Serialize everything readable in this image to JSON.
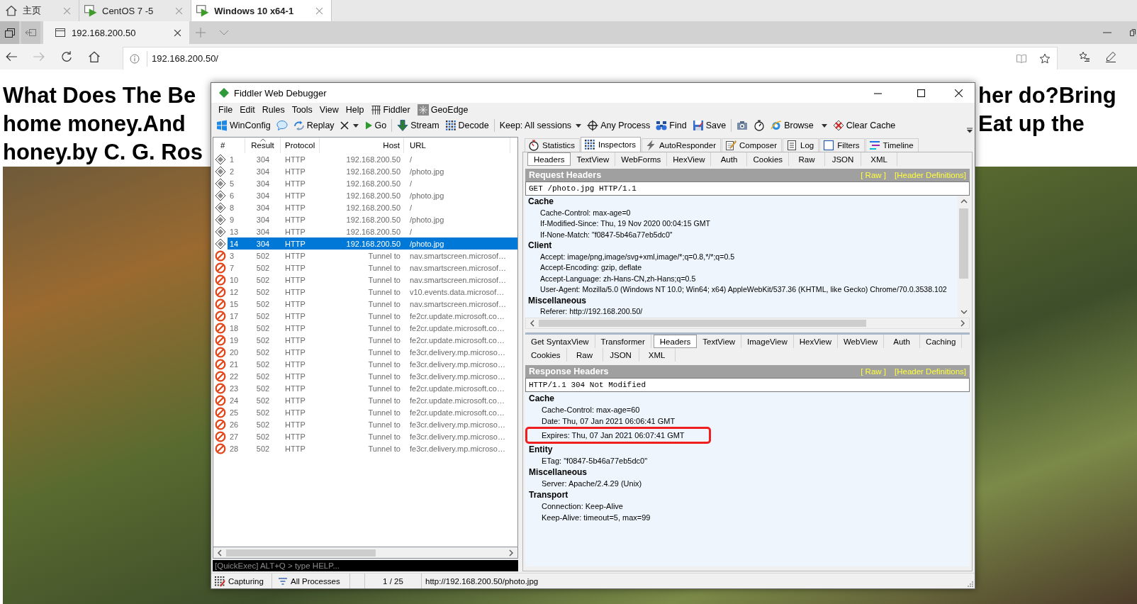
{
  "vm_tabs": [
    {
      "label": "主页",
      "kind": "home",
      "selected": false
    },
    {
      "label": "CentOS 7 -5",
      "kind": "vm",
      "selected": false
    },
    {
      "label": "Windows 10 x64-1",
      "kind": "vm",
      "selected": true
    }
  ],
  "browser": {
    "tab_title": "192.168.200.50",
    "nav": [
      {
        "kind": "back",
        "disabled": false
      },
      {
        "kind": "forward",
        "disabled": true
      },
      {
        "kind": "refresh",
        "disabled": false
      },
      {
        "kind": "home",
        "disabled": false
      }
    ],
    "address": "192.168.200.50/"
  },
  "page": {
    "heading_lines": [
      {
        "left": "What Does The Be",
        "right": "her do?Bring"
      },
      {
        "left": "home money.And",
        "right": "Eat up the"
      },
      {
        "left": "honey.by C. G. Ros"
      }
    ]
  },
  "fiddler": {
    "title": "Fiddler Web Debugger",
    "menu": [
      {
        "label": "File",
        "kind": "plain"
      },
      {
        "label": "Edit",
        "kind": "plain"
      },
      {
        "label": "Rules",
        "kind": "plain"
      },
      {
        "label": "Tools",
        "kind": "plain"
      },
      {
        "label": "View",
        "kind": "plain"
      },
      {
        "label": "Help",
        "kind": "plain"
      },
      {
        "label": "Fiddler",
        "kind": "script"
      },
      {
        "label": "GeoEdge",
        "kind": "addon"
      }
    ],
    "toolbar": [
      {
        "kind": "winconfig",
        "label": "WinConfig"
      },
      {
        "kind": "comment"
      },
      {
        "kind": "replay",
        "label": "Replay"
      },
      {
        "kind": "remove"
      },
      {
        "kind": "go",
        "label": "Go"
      },
      {
        "kind": "separator"
      },
      {
        "kind": "stream",
        "label": "Stream"
      },
      {
        "kind": "decode",
        "label": "Decode"
      },
      {
        "kind": "separator"
      },
      {
        "kind": "keep",
        "label": "Keep: All sessions"
      },
      {
        "kind": "process",
        "label": "Any Process"
      },
      {
        "kind": "find",
        "label": "Find"
      },
      {
        "kind": "save",
        "label": "Save"
      },
      {
        "kind": "separator"
      },
      {
        "kind": "screenshot"
      },
      {
        "kind": "timer"
      },
      {
        "kind": "browse",
        "label": "Browse"
      },
      {
        "kind": "menu"
      },
      {
        "kind": "clearcache",
        "label": "Clear Cache"
      }
    ],
    "sessions": {
      "columns": [
        {
          "label": "#",
          "sorted": false
        },
        {
          "label": "Result",
          "sorted": true
        },
        {
          "label": "Protocol",
          "sorted": false
        },
        {
          "label": "Host",
          "sorted": false
        },
        {
          "label": "URL",
          "sorted": false
        }
      ],
      "rows": [
        {
          "number": "1",
          "result": "304",
          "protocol": "HTTP",
          "host": "192.168.200.50",
          "url": "/",
          "kind": "notmodified",
          "selected": false
        },
        {
          "number": "2",
          "result": "304",
          "protocol": "HTTP",
          "host": "192.168.200.50",
          "url": "/photo.jpg",
          "kind": "notmodified",
          "selected": false
        },
        {
          "number": "5",
          "result": "304",
          "protocol": "HTTP",
          "host": "192.168.200.50",
          "url": "/",
          "kind": "notmodified",
          "selected": false
        },
        {
          "number": "6",
          "result": "304",
          "protocol": "HTTP",
          "host": "192.168.200.50",
          "url": "/photo.jpg",
          "kind": "notmodified",
          "selected": false
        },
        {
          "number": "8",
          "result": "304",
          "protocol": "HTTP",
          "host": "192.168.200.50",
          "url": "/",
          "kind": "notmodified",
          "selected": false
        },
        {
          "number": "9",
          "result": "304",
          "protocol": "HTTP",
          "host": "192.168.200.50",
          "url": "/photo.jpg",
          "kind": "notmodified",
          "selected": false
        },
        {
          "number": "13",
          "result": "304",
          "protocol": "HTTP",
          "host": "192.168.200.50",
          "url": "/",
          "kind": "notmodified",
          "selected": false
        },
        {
          "number": "14",
          "result": "304",
          "protocol": "HTTP",
          "host": "192.168.200.50",
          "url": "/photo.jpg",
          "kind": "notmodified",
          "selected": true
        },
        {
          "number": "3",
          "result": "502",
          "protocol": "HTTP",
          "host": "Tunnel to",
          "url": "nav.smartscreen.microsof…",
          "kind": "error",
          "selected": false
        },
        {
          "number": "7",
          "result": "502",
          "protocol": "HTTP",
          "host": "Tunnel to",
          "url": "nav.smartscreen.microsof…",
          "kind": "error",
          "selected": false
        },
        {
          "number": "10",
          "result": "502",
          "protocol": "HTTP",
          "host": "Tunnel to",
          "url": "nav.smartscreen.microsof…",
          "kind": "error",
          "selected": false
        },
        {
          "number": "12",
          "result": "502",
          "protocol": "HTTP",
          "host": "Tunnel to",
          "url": "v10.events.data.microsof…",
          "kind": "error",
          "selected": false
        },
        {
          "number": "15",
          "result": "502",
          "protocol": "HTTP",
          "host": "Tunnel to",
          "url": "nav.smartscreen.microsof…",
          "kind": "error",
          "selected": false
        },
        {
          "number": "17",
          "result": "502",
          "protocol": "HTTP",
          "host": "Tunnel to",
          "url": "fe2cr.update.microsoft.co…",
          "kind": "error",
          "selected": false
        },
        {
          "number": "18",
          "result": "502",
          "protocol": "HTTP",
          "host": "Tunnel to",
          "url": "fe2cr.update.microsoft.co…",
          "kind": "error",
          "selected": false
        },
        {
          "number": "19",
          "result": "502",
          "protocol": "HTTP",
          "host": "Tunnel to",
          "url": "fe2cr.update.microsoft.co…",
          "kind": "error",
          "selected": false
        },
        {
          "number": "20",
          "result": "502",
          "protocol": "HTTP",
          "host": "Tunnel to",
          "url": "fe3cr.delivery.mp.microso…",
          "kind": "error",
          "selected": false
        },
        {
          "number": "21",
          "result": "502",
          "protocol": "HTTP",
          "host": "Tunnel to",
          "url": "fe3cr.delivery.mp.microso…",
          "kind": "error",
          "selected": false
        },
        {
          "number": "22",
          "result": "502",
          "protocol": "HTTP",
          "host": "Tunnel to",
          "url": "fe3cr.delivery.mp.microso…",
          "kind": "error",
          "selected": false
        },
        {
          "number": "23",
          "result": "502",
          "protocol": "HTTP",
          "host": "Tunnel to",
          "url": "fe2cr.update.microsoft.co…",
          "kind": "error",
          "selected": false
        },
        {
          "number": "24",
          "result": "502",
          "protocol": "HTTP",
          "host": "Tunnel to",
          "url": "fe2cr.update.microsoft.co…",
          "kind": "error",
          "selected": false
        },
        {
          "number": "25",
          "result": "502",
          "protocol": "HTTP",
          "host": "Tunnel to",
          "url": "fe2cr.update.microsoft.co…",
          "kind": "error",
          "selected": false
        },
        {
          "number": "26",
          "result": "502",
          "protocol": "HTTP",
          "host": "Tunnel to",
          "url": "fe3cr.delivery.mp.microso…",
          "kind": "error",
          "selected": false
        },
        {
          "number": "27",
          "result": "502",
          "protocol": "HTTP",
          "host": "Tunnel to",
          "url": "fe3cr.delivery.mp.microso…",
          "kind": "error",
          "selected": false
        },
        {
          "number": "28",
          "result": "502",
          "protocol": "HTTP",
          "host": "Tunnel to",
          "url": "fe3cr.delivery.mp.microso…",
          "kind": "error",
          "selected": false
        }
      ]
    },
    "quickexec": {
      "placeholder": "[QuickExec] ALT+Q > type HELP..."
    },
    "inspectors": {
      "tabs": [
        {
          "label": "Statistics",
          "kind": "statistics",
          "selected": false
        },
        {
          "label": "Inspectors",
          "kind": "inspectors",
          "selected": true
        },
        {
          "label": "AutoResponder",
          "kind": "autoresponder",
          "selected": false
        },
        {
          "label": "Composer",
          "kind": "composer",
          "selected": false
        },
        {
          "label": "Log",
          "kind": "log",
          "selected": false
        },
        {
          "label": "Filters",
          "kind": "filters",
          "selected": false
        },
        {
          "label": "Timeline",
          "kind": "timeline",
          "selected": false
        }
      ],
      "request": {
        "tabs": [
          {
            "label": "Headers",
            "selected": true
          },
          {
            "label": "TextView",
            "selected": false
          },
          {
            "label": "WebForms",
            "selected": false
          },
          {
            "label": "HexView",
            "selected": false
          },
          {
            "label": "Auth",
            "selected": false
          },
          {
            "label": "Cookies",
            "selected": false
          },
          {
            "label": "Raw",
            "selected": false
          },
          {
            "label": "JSON",
            "selected": false
          },
          {
            "label": "XML",
            "selected": false
          }
        ],
        "title": "Request Headers",
        "links": [
          "[ Raw ]",
          "[Header Definitions]"
        ],
        "first_line": "GET /photo.jpg HTTP/1.1",
        "groups": [
          {
            "name": "Cache",
            "headers": [
              {
                "text": "Cache-Control: max-age=0",
                "highlighted": false
              },
              {
                "text": "If-Modified-Since: Thu, 19 Nov 2020 00:04:15 GMT",
                "highlighted": false
              },
              {
                "text": "If-None-Match: \"f0847-5b46a77eb5dc0\"",
                "highlighted": false
              }
            ]
          },
          {
            "name": "Client",
            "headers": [
              {
                "text": "Accept: image/png,image/svg+xml,image/*;q=0.8,*/*;q=0.5",
                "highlighted": false
              },
              {
                "text": "Accept-Encoding: gzip, deflate",
                "highlighted": false
              },
              {
                "text": "Accept-Language: zh-Hans-CN,zh-Hans;q=0.5",
                "highlighted": false
              },
              {
                "text": "User-Agent: Mozilla/5.0 (Windows NT 10.0; Win64; x64) AppleWebKit/537.36 (KHTML, like Gecko) Chrome/70.0.3538.102",
                "highlighted": false
              }
            ]
          },
          {
            "name": "Miscellaneous",
            "headers": [
              {
                "text": "Referer: http://192.168.200.50/",
                "highlighted": false
              }
            ]
          }
        ]
      },
      "response": {
        "tab_rows": [
          [
            {
              "label": "Get SyntaxView",
              "selected": false
            },
            {
              "label": "Transformer",
              "selected": false
            },
            {
              "label": "Headers",
              "selected": true
            },
            {
              "label": "TextView",
              "selected": false
            },
            {
              "label": "ImageView",
              "selected": false
            },
            {
              "label": "HexView",
              "selected": false
            },
            {
              "label": "WebView",
              "selected": false
            },
            {
              "label": "Auth",
              "selected": false
            },
            {
              "label": "Caching",
              "selected": false
            }
          ],
          [
            {
              "label": "Cookies",
              "selected": false
            },
            {
              "label": "Raw",
              "selected": false
            },
            {
              "label": "JSON",
              "selected": false
            },
            {
              "label": "XML",
              "selected": false
            }
          ]
        ],
        "title": "Response Headers",
        "links": [
          "[ Raw ]",
          "[Header Definitions]"
        ],
        "first_line": "HTTP/1.1 304 Not Modified",
        "groups": [
          {
            "name": "Cache",
            "headers": [
              {
                "text": "Cache-Control: max-age=60",
                "highlighted": false
              },
              {
                "text": "Date: Thu, 07 Jan 2021 06:06:41 GMT",
                "highlighted": false
              },
              {
                "text": "Expires: Thu, 07 Jan 2021 06:07:41 GMT",
                "highlighted": true
              }
            ]
          },
          {
            "name": "Entity",
            "headers": [
              {
                "text": "ETag: \"f0847-5b46a77eb5dc0\"",
                "highlighted": false
              }
            ]
          },
          {
            "name": "Miscellaneous",
            "headers": [
              {
                "text": "Server: Apache/2.4.29 (Unix)",
                "highlighted": false
              }
            ]
          },
          {
            "name": "Transport",
            "headers": [
              {
                "text": "Connection: Keep-Alive",
                "highlighted": false
              },
              {
                "text": "Keep-Alive: timeout=5, max=99",
                "highlighted": false
              }
            ]
          }
        ]
      }
    },
    "status_bar": {
      "capture": "Capturing",
      "processes": "All Processes",
      "count": "1 / 25",
      "url": "http://192.168.200.50/photo.jpg"
    }
  }
}
